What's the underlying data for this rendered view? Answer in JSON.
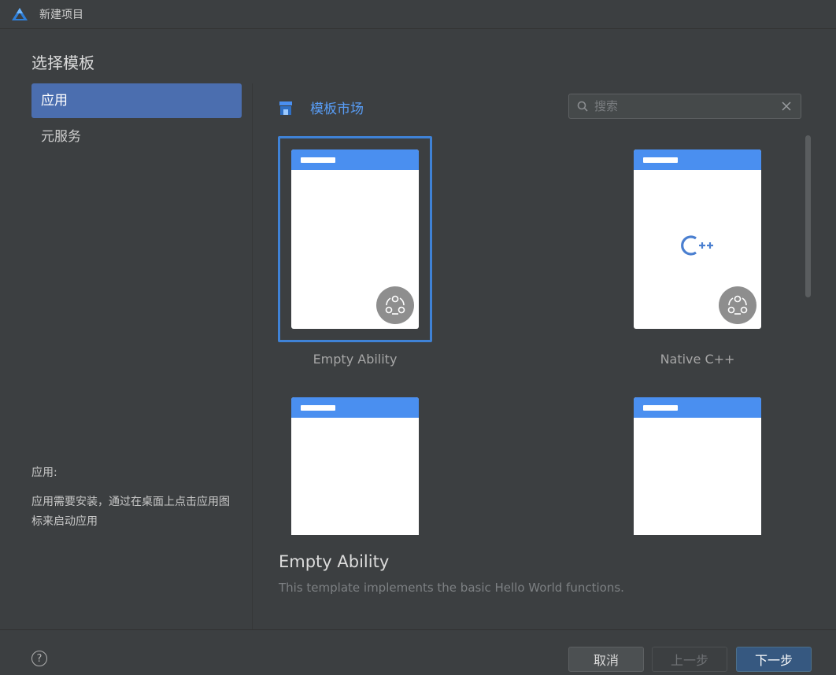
{
  "window": {
    "title": "新建项目"
  },
  "heading": "选择模板",
  "nav": {
    "items": [
      {
        "label": "应用",
        "active": true
      },
      {
        "label": "元服务",
        "active": false
      }
    ]
  },
  "description": {
    "title": "应用:",
    "text": "应用需要安装，通过在桌面上点击应用图标来启动应用"
  },
  "market": {
    "label": "模板市场"
  },
  "search": {
    "placeholder": "搜索",
    "value": ""
  },
  "templates": [
    {
      "name": "Empty Ability",
      "selected": true,
      "icon": "ability-badge-icon"
    },
    {
      "name": "Native C++",
      "selected": false,
      "icon": "cpp-icon"
    },
    {
      "name": "",
      "selected": false
    },
    {
      "name": "",
      "selected": false
    }
  ],
  "detail": {
    "title": "Empty Ability",
    "text": "This template implements the basic Hello World functions."
  },
  "footer": {
    "help": "?",
    "cancel": "取消",
    "prev": "上一步",
    "next": "下一步"
  },
  "colors": {
    "accent": "#4b6eaf",
    "selection": "#3f82d6",
    "link": "#589df6",
    "phone_bar": "#4a8ff0",
    "background": "#3c3f41"
  }
}
